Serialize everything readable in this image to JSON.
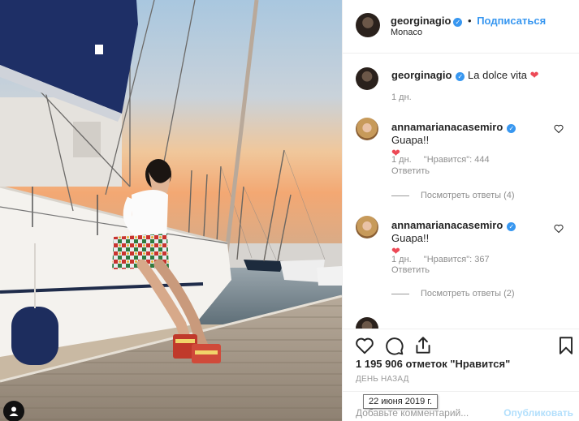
{
  "post": {
    "author": "georginagio",
    "follow_separator": "•",
    "follow_label": "Подписаться",
    "location": "Monaco"
  },
  "comments": [
    {
      "user": "georginagio",
      "text": "La dolce vita",
      "heart": "❤",
      "time": "1 дн.",
      "verified": true
    },
    {
      "user": "annamarianacasemiro",
      "text": "Guapa!!",
      "heart": "❤",
      "time": "1 дн.",
      "likes": "\"Нравится\": 444",
      "reply_label": "Ответить",
      "view_replies": "Посмотреть ответы (4)"
    },
    {
      "user": "annamarianacasemiro",
      "text": "Guapa!!",
      "heart": "❤",
      "time": "1 дн.",
      "likes": "\"Нравится\": 367",
      "reply_label": "Ответить",
      "view_replies": "Посмотреть ответы (2)"
    },
    {
      "user": "",
      "text": ""
    }
  ],
  "likes_count": "1 195 906 отметок \"Нравится\"",
  "posted_label": "ДЕНЬ НАЗАД",
  "date_tooltip": "22 июня 2019 г.",
  "add_comment": {
    "placeholder": "Добавьте комментарий...",
    "post_label": "Опубликовать"
  },
  "icons": [
    "heart-icon",
    "comment-icon",
    "share-icon",
    "bookmark-icon",
    "verified-badge-icon",
    "small-heart-icon",
    "profile-icon"
  ],
  "colors": {
    "link_blue": "#3897f0",
    "heart_red": "#ed4956",
    "muted_gray": "#8e8e8e",
    "disabled_blue": "#b2dffc"
  }
}
